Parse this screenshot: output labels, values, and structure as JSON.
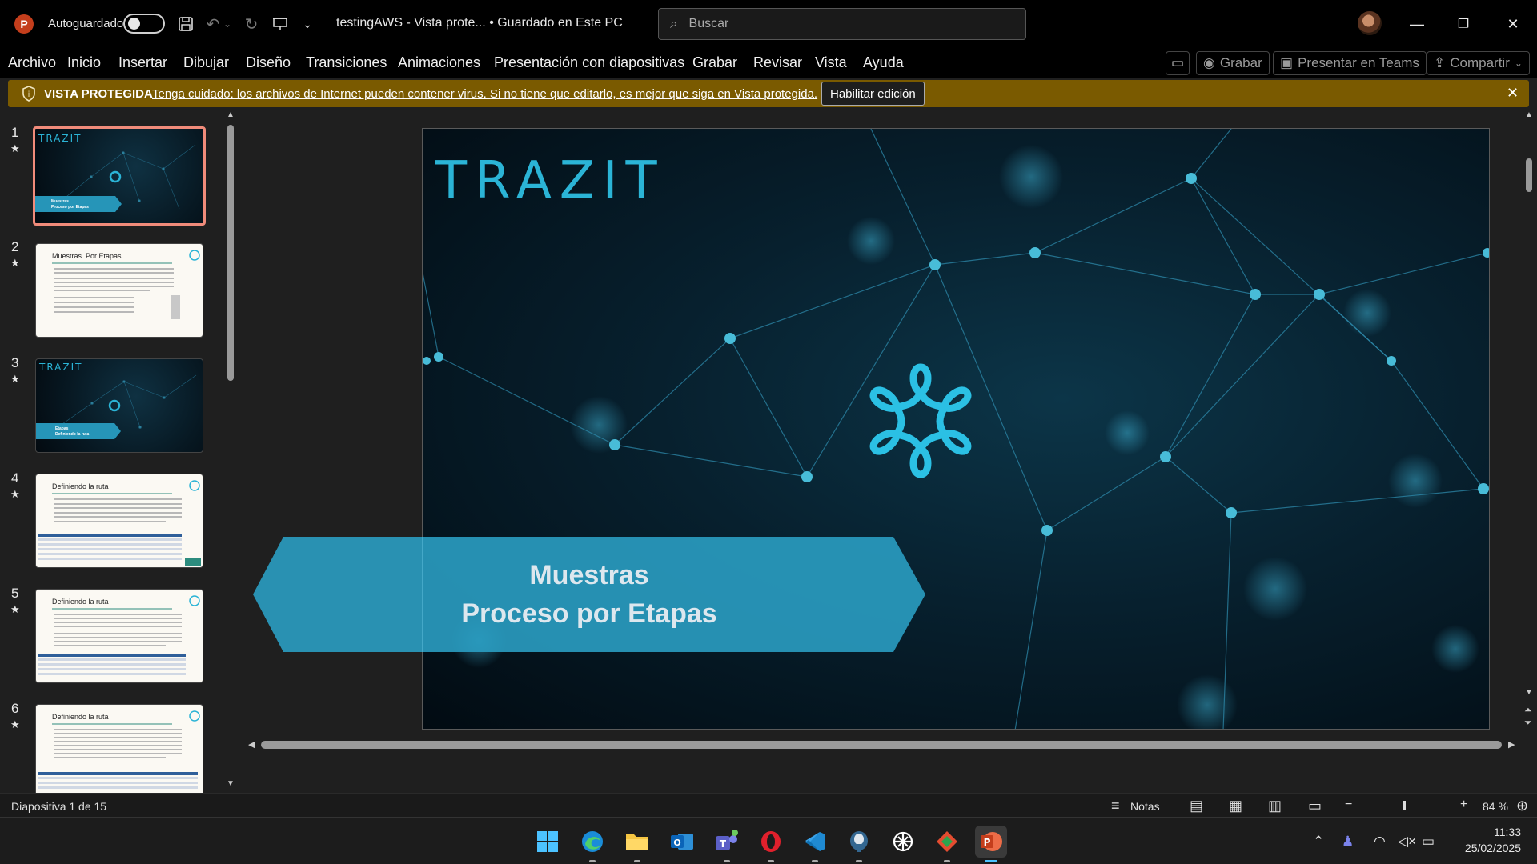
{
  "titlebar": {
    "autosave_label": "Autoguardado",
    "document_title": "testingAWS  -  Vista prote...  •  Guardado en Este PC",
    "search_placeholder": "Buscar"
  },
  "ribbon": {
    "tabs": [
      "Archivo",
      "Inicio",
      "Insertar",
      "Dibujar",
      "Diseño",
      "Transiciones",
      "Animaciones",
      "Presentación con diapositivas",
      "Grabar",
      "Revisar",
      "Vista",
      "Ayuda"
    ],
    "record_label": "Grabar",
    "present_teams_label": "Presentar en Teams",
    "share_label": "Compartir"
  },
  "protected_view": {
    "title": "VISTA PROTEGIDA",
    "message": "Tenga cuidado: los archivos de Internet pueden contener virus. Si no tiene que editarlo, es mejor que siga en Vista protegida.",
    "enable_button": "Habilitar edición"
  },
  "thumbnails": [
    {
      "number": "1",
      "title": "TRAZIT",
      "banner": "Muestras\nProceso por Etapas",
      "style": "dark",
      "selected": true
    },
    {
      "number": "2",
      "title": "Muestras. Por Etapas",
      "style": "light"
    },
    {
      "number": "3",
      "title": "TRAZIT",
      "banner": "Etapas\nDefiniendo la ruta",
      "style": "dark"
    },
    {
      "number": "4",
      "title": "Definiendo la ruta",
      "style": "light"
    },
    {
      "number": "5",
      "title": "Definiendo la ruta",
      "style": "light"
    },
    {
      "number": "6",
      "title": "Definiendo la ruta",
      "style": "light"
    }
  ],
  "slide": {
    "brand": "TRAZIT",
    "banner_line1": "Muestras",
    "banner_line2": "Proceso por Etapas",
    "accent_color": "#2bb4d6"
  },
  "statusbar": {
    "slide_counter": "Diapositiva 1 de 15",
    "notes_label": "Notas",
    "zoom": "84 %"
  },
  "taskbar": {
    "time": "11:33",
    "date": "25/02/2025"
  }
}
